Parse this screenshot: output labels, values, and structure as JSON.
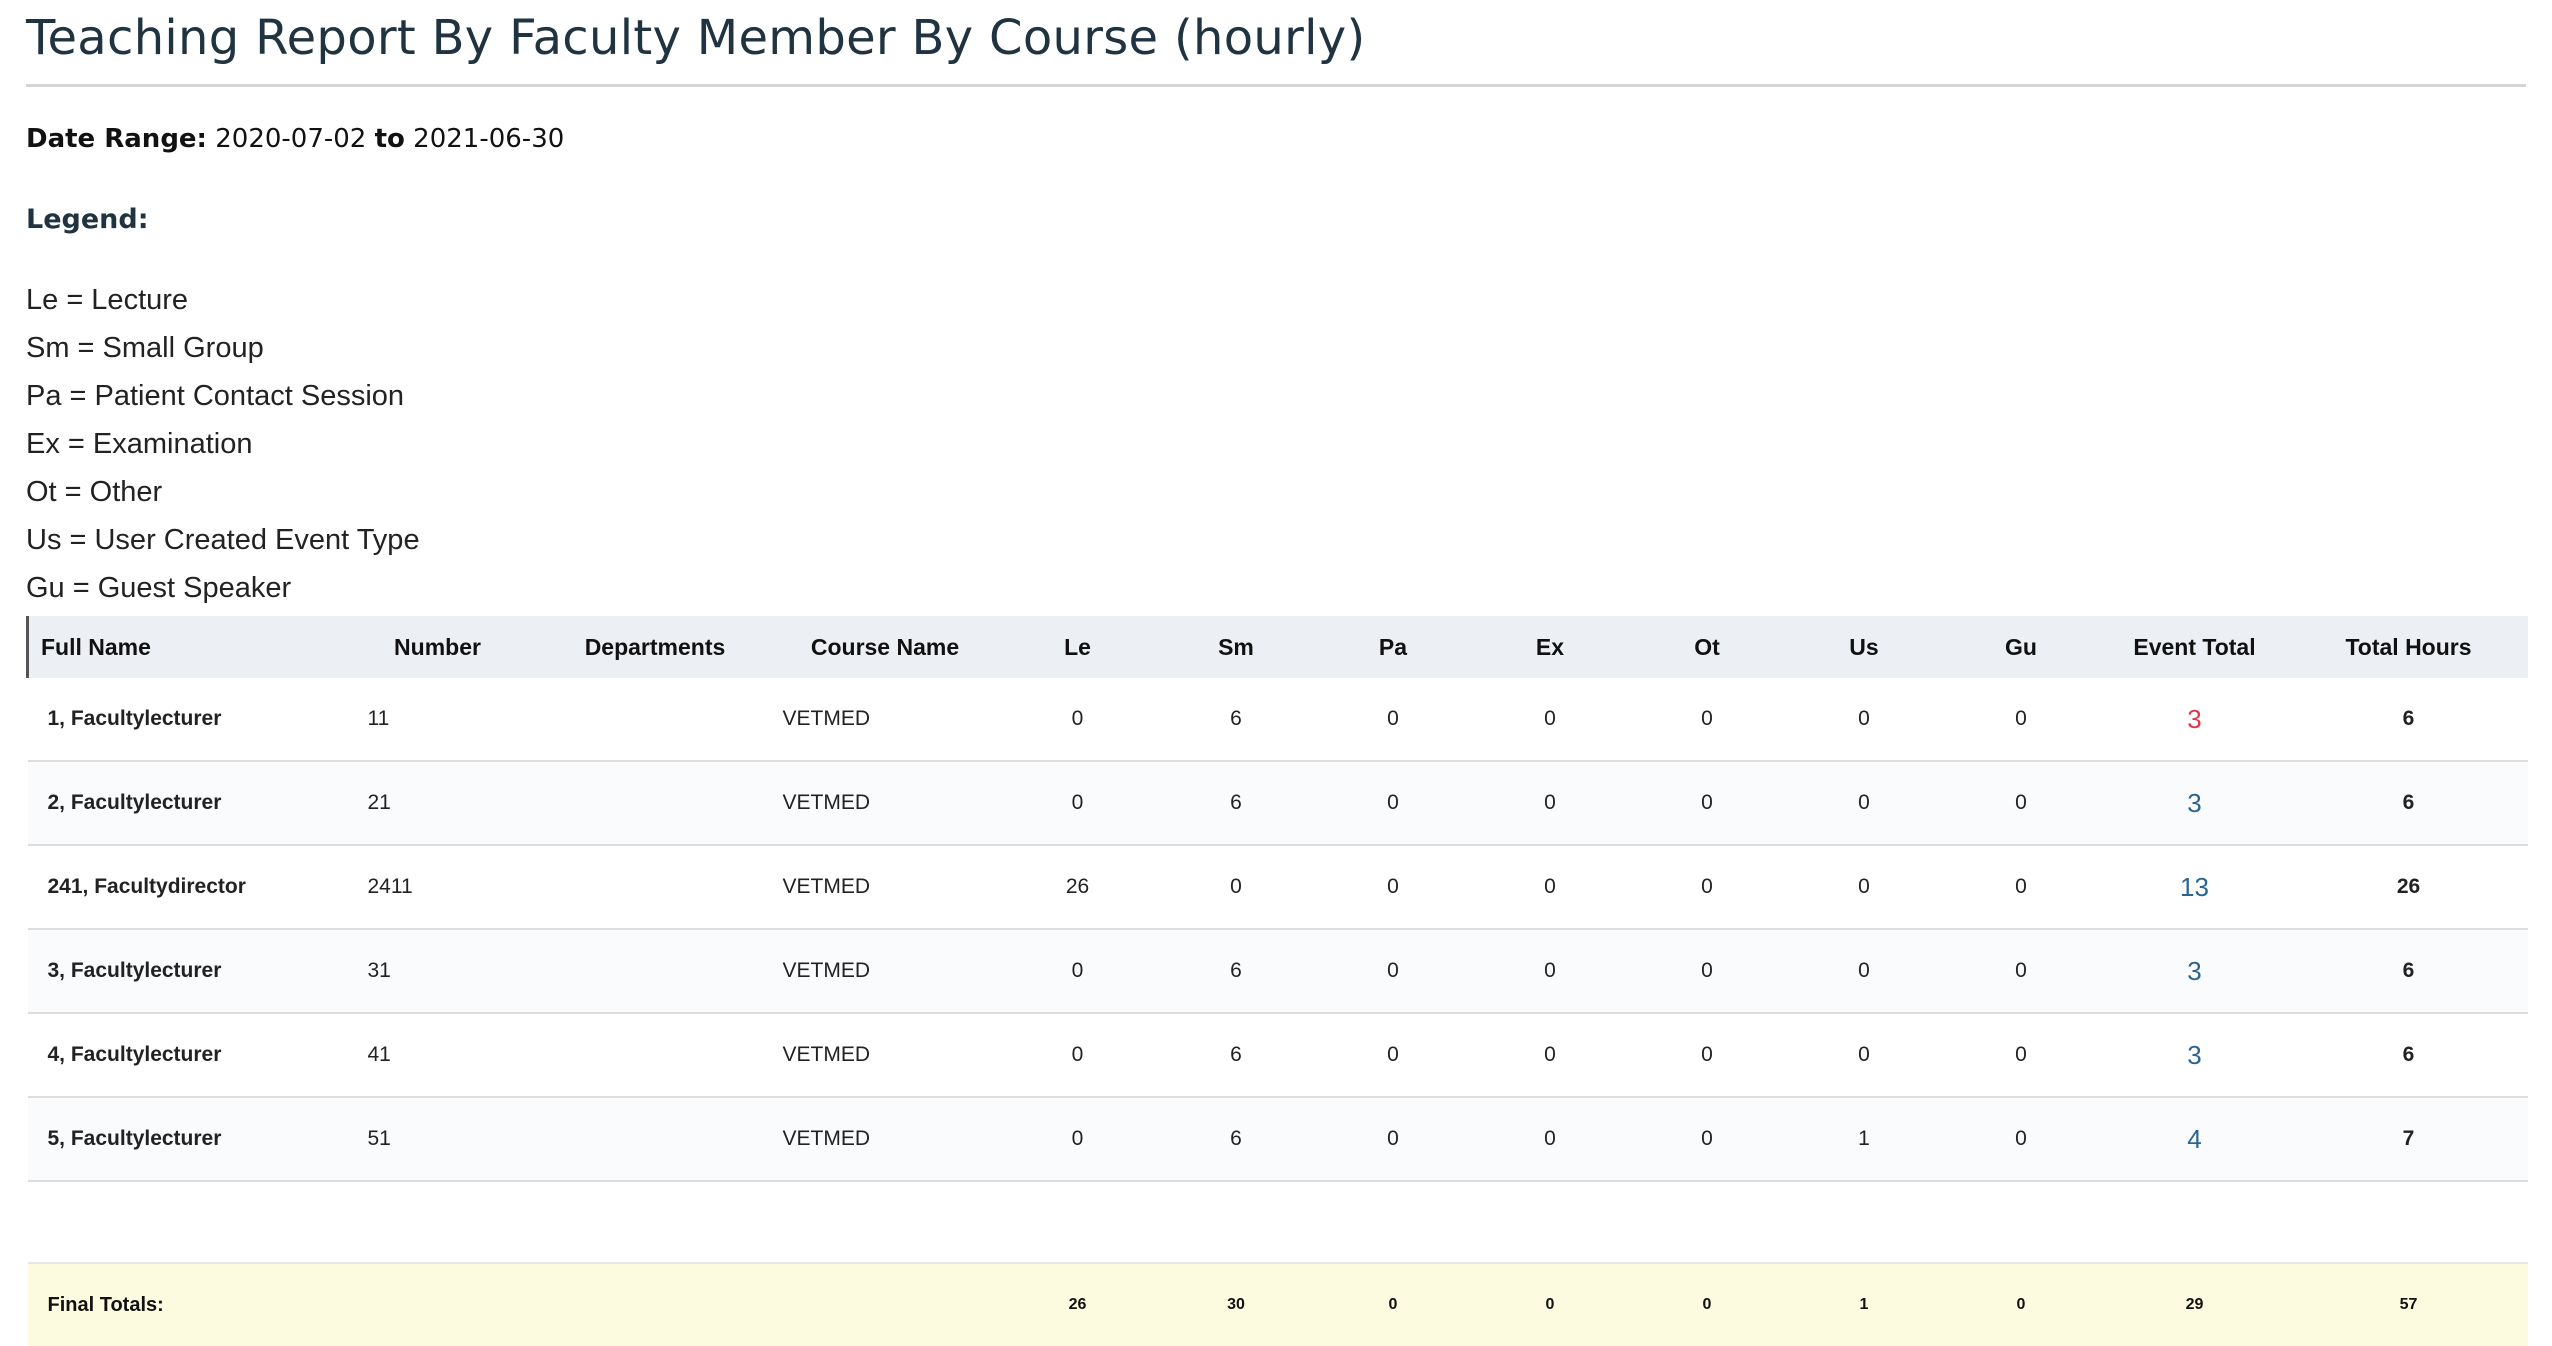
{
  "report": {
    "title": "Teaching Report By Faculty Member By Course (hourly)",
    "date_range": {
      "label": "Date Range:",
      "start": "2020-07-02",
      "connector": "to",
      "end": "2021-06-30"
    }
  },
  "legend": {
    "heading": "Legend:",
    "items": [
      "Le = Lecture",
      "Sm = Small Group",
      "Pa = Patient Contact Session",
      "Ex = Examination",
      "Ot = Other",
      "Us = User Created Event Type",
      "Gu = Guest Speaker"
    ]
  },
  "table": {
    "headers": {
      "full_name": "Full Name",
      "number": "Number",
      "departments": "Departments",
      "course_name": "Course Name",
      "le": "Le",
      "sm": "Sm",
      "pa": "Pa",
      "ex": "Ex",
      "ot": "Ot",
      "us": "Us",
      "gu": "Gu",
      "event_total": "Event Total",
      "total_hours": "Total Hours"
    },
    "rows": [
      {
        "full_name": "1, Facultylecturer",
        "number": "11",
        "departments": "",
        "course_name": "VETMED",
        "le": "0",
        "sm": "6",
        "pa": "0",
        "ex": "0",
        "ot": "0",
        "us": "0",
        "gu": "0",
        "event_total": "3",
        "total_hours": "6"
      },
      {
        "full_name": "2, Facultylecturer",
        "number": "21",
        "departments": "",
        "course_name": "VETMED",
        "le": "0",
        "sm": "6",
        "pa": "0",
        "ex": "0",
        "ot": "0",
        "us": "0",
        "gu": "0",
        "event_total": "3",
        "total_hours": "6"
      },
      {
        "full_name": "241, Facultydirector",
        "number": "2411",
        "departments": "",
        "course_name": "VETMED",
        "le": "26",
        "sm": "0",
        "pa": "0",
        "ex": "0",
        "ot": "0",
        "us": "0",
        "gu": "0",
        "event_total": "13",
        "total_hours": "26"
      },
      {
        "full_name": "3, Facultylecturer",
        "number": "31",
        "departments": "",
        "course_name": "VETMED",
        "le": "0",
        "sm": "6",
        "pa": "0",
        "ex": "0",
        "ot": "0",
        "us": "0",
        "gu": "0",
        "event_total": "3",
        "total_hours": "6"
      },
      {
        "full_name": "4, Facultylecturer",
        "number": "41",
        "departments": "",
        "course_name": "VETMED",
        "le": "0",
        "sm": "6",
        "pa": "0",
        "ex": "0",
        "ot": "0",
        "us": "0",
        "gu": "0",
        "event_total": "3",
        "total_hours": "6"
      },
      {
        "full_name": "5, Facultylecturer",
        "number": "51",
        "departments": "",
        "course_name": "VETMED",
        "le": "0",
        "sm": "6",
        "pa": "0",
        "ex": "0",
        "ot": "0",
        "us": "1",
        "gu": "0",
        "event_total": "4",
        "total_hours": "7"
      }
    ],
    "totals": {
      "label": "Final Totals:",
      "le": "26",
      "sm": "30",
      "pa": "0",
      "ex": "0",
      "ot": "0",
      "us": "1",
      "gu": "0",
      "event_total": "29",
      "total_hours": "57"
    }
  },
  "colors": {
    "title": "#1f3340",
    "header_bg": "#eceff3",
    "event_link": "#2a6592",
    "event_link_highlight": "#e0364d",
    "totals_bg": "#fcfbdf"
  }
}
